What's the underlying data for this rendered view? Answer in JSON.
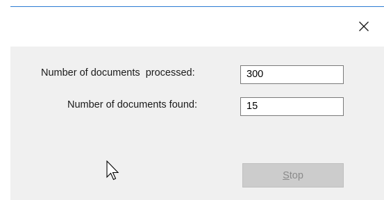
{
  "dialog": {
    "close_icon": "close-icon",
    "processed_label": "Number of documents  processed:",
    "processed_value": "300",
    "found_label": "Number of documents found:",
    "found_value": "15",
    "stop_button": {
      "mnemonic": "S",
      "rest": "top",
      "enabled": false
    },
    "accent_color": "#2b7bd3",
    "cursor_icon": "arrow-cursor-icon"
  }
}
